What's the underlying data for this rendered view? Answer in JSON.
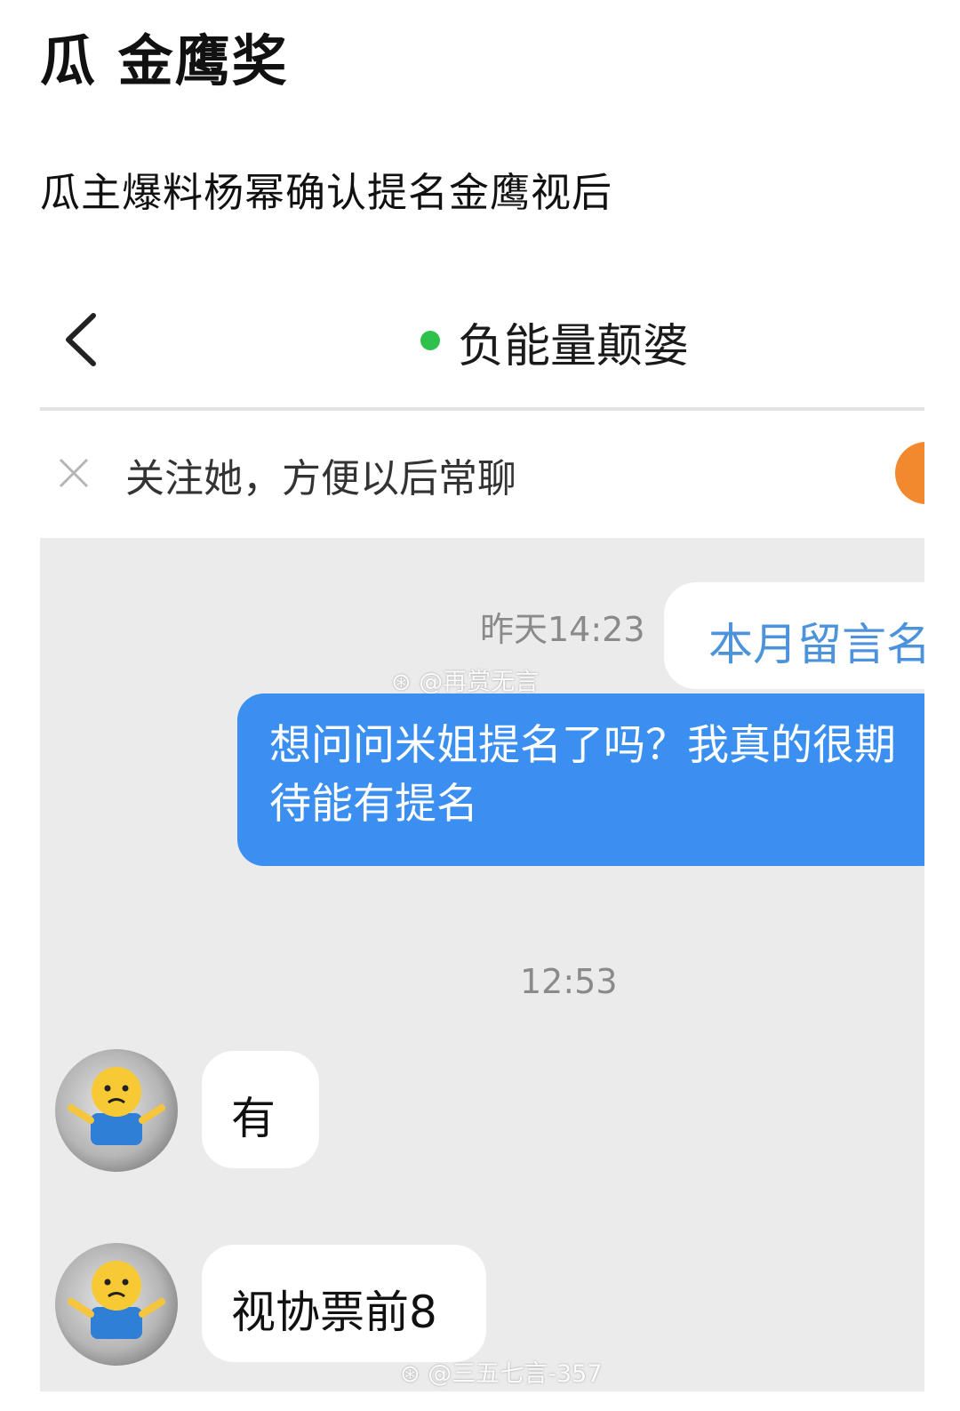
{
  "post": {
    "title": "瓜 金鹰奖",
    "text": "瓜主爆料杨幂确认提名金鹰视后"
  },
  "chat": {
    "contact_name": "负能量颠婆",
    "follow_prompt": "关注她，方便以后常聊",
    "messages": [
      {
        "time": "昨天14:23",
        "preview": "本月留言名",
        "sender": "me",
        "text": "想问问米姐提名了吗？我真的很期待能有提名"
      },
      {
        "time": "12:53"
      },
      {
        "sender": "contact",
        "text": "有"
      },
      {
        "sender": "contact",
        "text": "视协票前8"
      }
    ]
  },
  "watermarks": [
    "@再赏无言",
    "@三五七言-357"
  ],
  "colors": {
    "accent_blue": "#3b8ff0",
    "online_green": "#2ec14b",
    "follow_orange": "#f3892f",
    "chat_background": "#ebebec"
  },
  "icons": [
    "back-arrow-icon",
    "close-icon",
    "online-status-icon",
    "avatar-emoji-icon",
    "weibo-logo-icon"
  ]
}
